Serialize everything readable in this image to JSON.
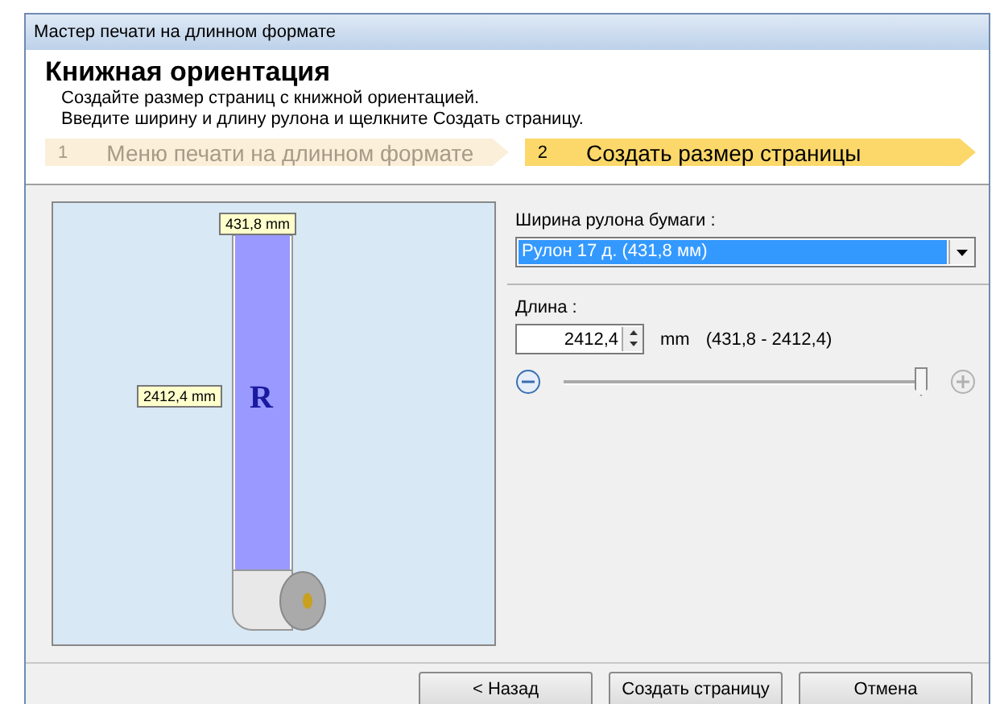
{
  "window": {
    "title": "Мастер печати на длинном формате"
  },
  "header": {
    "title": "Книжная ориентация",
    "lines": [
      "Создайте  размер  страниц  с  книжной  ориентацией.",
      "Введите ширину и длину рулона и щелкните Создать страницу."
    ]
  },
  "steps": [
    {
      "number": "1",
      "label": "Меню печати на длинном формате",
      "selected": false
    },
    {
      "number": "2",
      "label": "Создать размер страницы",
      "selected": true
    }
  ],
  "preview": {
    "width_label": "431,8 mm",
    "length_label": "2412,4 mm",
    "mark": "R"
  },
  "roll_width": {
    "label": "Ширина рулона бумаги :",
    "value": "Рулон 17 д. (431,8 мм)"
  },
  "length": {
    "label": "Длина :",
    "value": "2412,4",
    "unit": "mm",
    "range": "(431,8 - 2412,4)",
    "level": 1,
    "minus_disabled": false,
    "plus_disabled": true
  },
  "buttons": [
    "< Назад",
    "Создать страницу",
    "Отмена"
  ]
}
